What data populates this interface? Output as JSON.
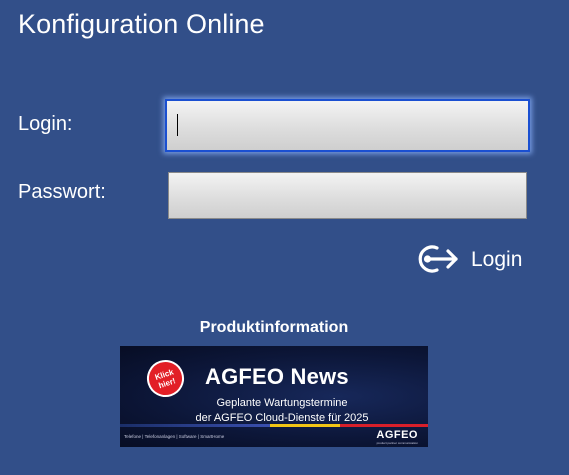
{
  "page": {
    "title": "Konfiguration Online"
  },
  "form": {
    "login_label": "Login:",
    "login_value": "",
    "password_label": "Passwort:",
    "password_value": "",
    "submit_label": "Login",
    "submit_icon": "login-arrow-icon"
  },
  "product": {
    "heading": "Produktinformation"
  },
  "banner": {
    "badge": "Klick\nhier!",
    "title": "AGFEO News",
    "line1": "Geplante Wartungstermine",
    "line2": "der AGFEO Cloud-Dienste für 2025",
    "footer": "Telefone | Telefonanlagen | Software | SmartHome",
    "logo": "AGFEO",
    "logo_sub": "product partner communication",
    "colors": {
      "badge": "#e21f26",
      "stripe_yellow": "#f2c515",
      "stripe_red": "#d81f2a"
    }
  },
  "colors": {
    "background": "#324f89",
    "focus_border": "#1a4fd1"
  }
}
